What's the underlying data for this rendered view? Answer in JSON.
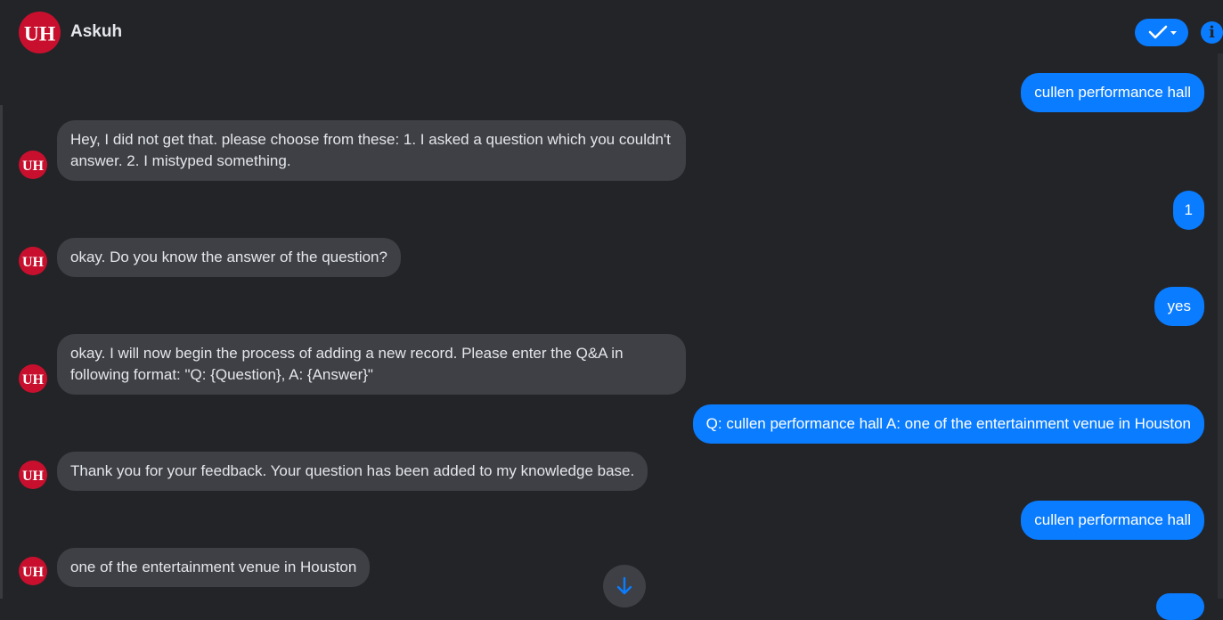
{
  "header": {
    "title": "Askuh",
    "logo_icon": "uh-logo-icon",
    "status_icon": "check-chevron-icon",
    "info_icon": "info-icon"
  },
  "colors": {
    "background": "#232427",
    "bot_bubble": "#3e4045",
    "user_bubble": "#0a7cff",
    "brand_red": "#c8102e"
  },
  "messages": [
    {
      "from": "user",
      "text": "cullen performance hall"
    },
    {
      "from": "bot",
      "text": "Hey, I did not get that. please choose from these: 1. I asked a question which you couldn't answer. 2. I mistyped something."
    },
    {
      "from": "user",
      "text": "1"
    },
    {
      "from": "bot",
      "text": "okay. Do you know the answer of the question?"
    },
    {
      "from": "user",
      "text": "yes"
    },
    {
      "from": "bot",
      "text": "okay. I will now begin the process of adding a new record. Please enter the Q&A in following format: \"Q: {Question}, A: {Answer}\""
    },
    {
      "from": "user",
      "text": "Q: cullen performance hall A: one of the entertainment venue in Houston"
    },
    {
      "from": "bot",
      "text": "Thank you for your feedback. Your question has been added to my knowledge base."
    },
    {
      "from": "user",
      "text": "cullen performance hall"
    },
    {
      "from": "bot",
      "text": "one of the entertainment venue in Houston"
    }
  ],
  "scroll_down_icon": "arrow-down-icon"
}
